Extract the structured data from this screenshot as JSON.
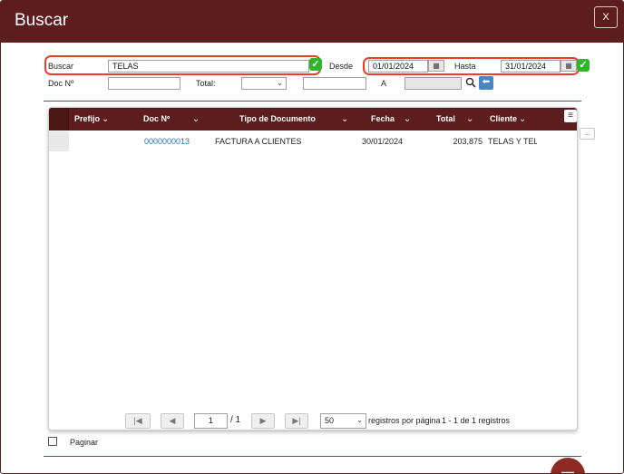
{
  "dialog": {
    "title": "Buscar",
    "close_label": "X"
  },
  "filters": {
    "buscar_label": "Buscar",
    "buscar_value": "TELAS",
    "desde_label": "Desde",
    "desde_value": "01/01/2024",
    "hasta_label": "Hasta",
    "hasta_value": "31/01/2024",
    "doc_label": "Doc Nº",
    "doc_value": "",
    "total_label": "Total:",
    "total_select": "",
    "total_value": "",
    "a_label": "A",
    "a_value": ""
  },
  "grid": {
    "columns": [
      "Prefijo",
      "Doc Nº",
      "Tipo de Documento",
      "Fecha",
      "Total",
      "Cliente"
    ],
    "rows": [
      {
        "prefijo": "",
        "doc": "0000000013",
        "tipo": "FACTURA A CLIENTES",
        "fecha": "30/01/2024",
        "total": "203,875",
        "cliente": "TELAS Y TELAS"
      }
    ],
    "side_button": "..."
  },
  "pagination": {
    "page": "1",
    "of_pages": "/ 1",
    "per_page": "50",
    "per_page_label": "registros por página",
    "summary": "1 - 1 de 1 registros"
  },
  "footer": {
    "paginar_label": "Paginar"
  },
  "colors": {
    "header": "#5b1d1d",
    "highlight": "#e8402b",
    "check": "#2fb52a",
    "link": "#2a6fb2"
  }
}
